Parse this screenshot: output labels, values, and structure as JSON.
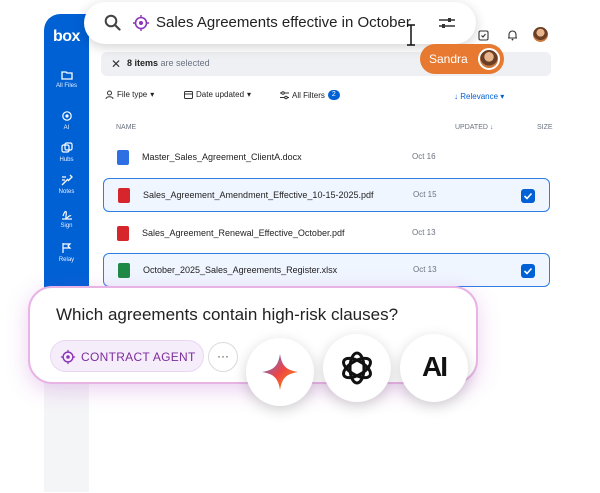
{
  "app": {
    "brand": "box"
  },
  "sidebar": {
    "items": [
      {
        "label": "All Files",
        "icon": "folder-icon"
      },
      {
        "label": "AI",
        "icon": "ai-sparkle-icon"
      },
      {
        "label": "Hubs",
        "icon": "hubs-icon"
      },
      {
        "label": "Notes",
        "icon": "notes-icon"
      },
      {
        "label": "Sign",
        "icon": "sign-icon"
      },
      {
        "label": "Relay",
        "icon": "relay-icon"
      }
    ]
  },
  "search": {
    "query": "Sales Agreements effective in October"
  },
  "user": {
    "name": "Sandra"
  },
  "selection": {
    "count": "8 items",
    "suffix": "are selected"
  },
  "filters": {
    "file_type": "File type",
    "date_updated": "Date updated",
    "all_filters": "All Filters",
    "filter_count": "2",
    "sort": "Relevance"
  },
  "columns": {
    "name": "NAME",
    "updated": "UPDATED",
    "size": "SIZE"
  },
  "files": [
    {
      "name": "Master_Sales_Agreement_ClientA.docx",
      "date": "Oct 16",
      "type": "docx",
      "selected": false
    },
    {
      "name": "Sales_Agreement_Amendment_Effective_10-15-2025.pdf",
      "date": "Oct 15",
      "type": "pdf",
      "selected": true
    },
    {
      "name": "Sales_Agreement_Renewal_Effective_October.pdf",
      "date": "Oct 13",
      "type": "pdf",
      "selected": false
    },
    {
      "name": "October_2025_Sales_Agreements_Register.xlsx",
      "date": "Oct 13",
      "type": "xlsx",
      "selected": true
    }
  ],
  "prompt": {
    "question": "Which agreements contain high-risk clauses?",
    "agent_label": "CONTRACT AGENT",
    "more": "···",
    "models": [
      "gemini-icon",
      "openai-icon",
      "anthropic-icon"
    ],
    "anthropic_mark": "AI"
  },
  "colors": {
    "brand_blue": "#0061d5",
    "accent_orange": "#e77a30",
    "agent_purple": "#7a2d9c",
    "pdf_red": "#d6262b",
    "docx_blue": "#2f6fe4",
    "xlsx_green": "#1e8a44"
  }
}
